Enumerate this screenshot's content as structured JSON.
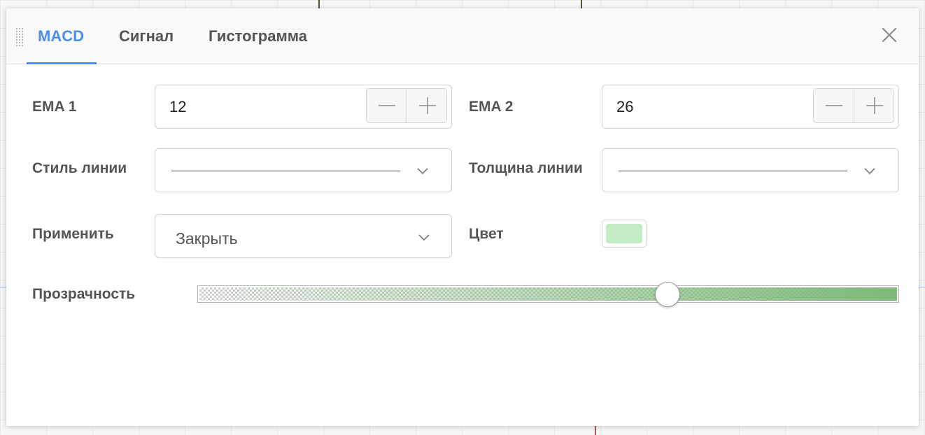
{
  "tabs": [
    {
      "label": "MACD",
      "active": true
    },
    {
      "label": "Сигнал",
      "active": false
    },
    {
      "label": "Гистограмма",
      "active": false
    }
  ],
  "icons": {
    "drag": "drag-handle-icon",
    "close": "close-icon",
    "minus": "minus-icon",
    "plus": "plus-icon",
    "dropdown": "chevron-down-icon"
  },
  "fields": {
    "ema1": {
      "label": "EMA 1",
      "value": "12"
    },
    "ema2": {
      "label": "EMA 2",
      "value": "26"
    },
    "line_style": {
      "label": "Стиль линии"
    },
    "line_width": {
      "label": "Толщина линии"
    },
    "apply": {
      "label": "Применить",
      "selected": "Закрыть"
    },
    "color": {
      "label": "Цвет",
      "value": "#c3ecc5"
    },
    "opacity": {
      "label": "Прозрачность",
      "value_percent": 67
    }
  },
  "colors": {
    "accent": "#4d8ee8",
    "slider_fill": "#7db979",
    "swatch": "#c3ecc5"
  }
}
